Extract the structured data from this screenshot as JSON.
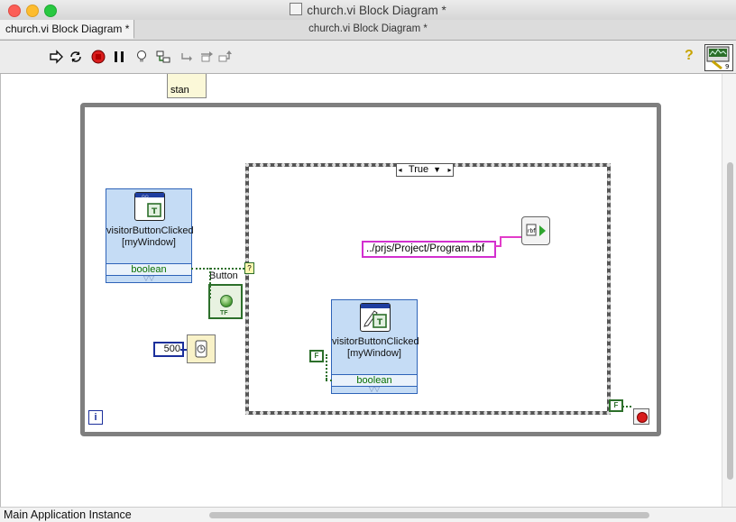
{
  "window": {
    "title": "church.vi Block Diagram *"
  },
  "tabs": {
    "active_tab": "church.vi Block Diagram *",
    "center_title": "church.vi Block Diagram *"
  },
  "toolbar": {
    "icons": [
      "run-arrow-icon",
      "run-continuously-icon",
      "abort-icon",
      "pause-icon",
      "highlight-execution-icon",
      "retain-wire-values-icon",
      "step-into-icon",
      "step-over-icon",
      "step-out-icon",
      "context-help-icon",
      "vi-icon"
    ],
    "help_label": "?"
  },
  "diagram": {
    "stan_label": "stan",
    "case_selector": "True",
    "path_constant": "../prjs/Project/Program.rbf",
    "property_node_1": {
      "title": "visitorButtonClicked [myWindow]",
      "row": "boolean"
    },
    "property_node_2": {
      "title": "visitorButtonClicked [myWindow]",
      "row": "boolean"
    },
    "button_label": "Button",
    "button_tf": "TF",
    "wait_constant": "500",
    "false_constant": "F",
    "iteration_label": "i"
  },
  "status": {
    "text": "Main Application Instance"
  },
  "colors": {
    "boolean_wire": "#2c6f2a",
    "path_wire": "#e23cc9",
    "integer_wire": "#1b2f9b",
    "stop": "#d91d1d"
  }
}
